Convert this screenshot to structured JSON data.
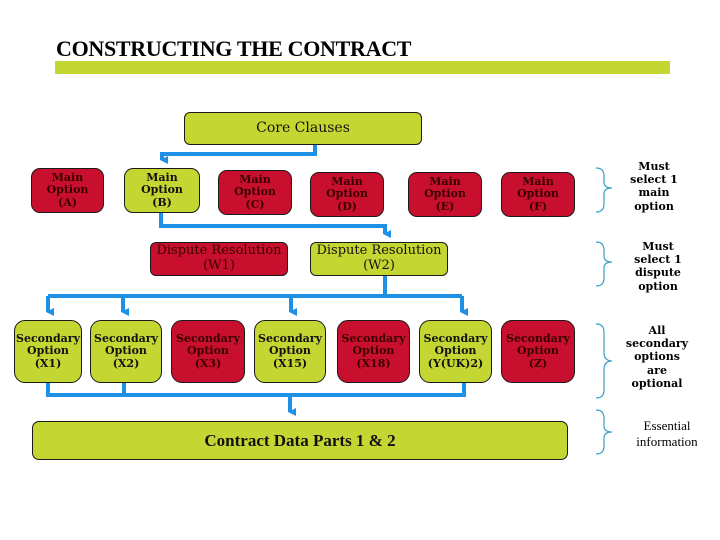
{
  "title": "CONSTRUCTING THE CONTRACT",
  "colors": {
    "selected": "#c4d632",
    "unselected": "#c8102e",
    "connector": "#1e90e6",
    "brace": "#3aa0c8"
  },
  "core_clauses": {
    "label": "Core Clauses",
    "state": "selected"
  },
  "main_options": [
    {
      "line1": "Main Option",
      "line2": "(A)",
      "state": "unselected"
    },
    {
      "line1": "Main Option",
      "line2": "(B)",
      "state": "selected"
    },
    {
      "line1": "Main Option",
      "line2": "(C)",
      "state": "unselected"
    },
    {
      "line1": "Main Option",
      "line2": "(D)",
      "state": "unselected"
    },
    {
      "line1": "Main Option",
      "line2": "(E)",
      "state": "unselected"
    },
    {
      "line1": "Main Option",
      "line2": "(F)",
      "state": "unselected"
    }
  ],
  "dispute_options": [
    {
      "line1": "Dispute Resolution",
      "line2": "(W1)",
      "state": "unselected"
    },
    {
      "line1": "Dispute Resolution",
      "line2": "(W2)",
      "state": "selected"
    }
  ],
  "secondary_options": [
    {
      "line1": "Secondary",
      "line2": "Option",
      "line3": "(X1)",
      "state": "selected"
    },
    {
      "line1": "Secondary",
      "line2": "Option",
      "line3": "(X2)",
      "state": "selected"
    },
    {
      "line1": "Secondary",
      "line2": "Option",
      "line3": "(X3)",
      "state": "unselected"
    },
    {
      "line1": "Secondary",
      "line2": "Option",
      "line3": "(X15)",
      "state": "selected"
    },
    {
      "line1": "Secondary",
      "line2": "Option",
      "line3": "(X18)",
      "state": "unselected"
    },
    {
      "line1": "Secondary",
      "line2": "Option",
      "line3": "(Y(UK)2)",
      "state": "selected"
    },
    {
      "line1": "Secondary",
      "line2": "Option",
      "line3": "(Z)",
      "state": "unselected"
    }
  ],
  "contract_data": {
    "label": "Contract Data Parts 1 & 2",
    "state": "selected"
  },
  "notes": [
    {
      "lines": [
        "Must",
        "select 1",
        "main",
        "option"
      ]
    },
    {
      "lines": [
        "Must",
        "select 1",
        "dispute",
        "option"
      ]
    },
    {
      "lines": [
        "All",
        "secondary",
        "options",
        "are",
        "optional"
      ]
    },
    {
      "lines": [
        "Essential",
        "information"
      ]
    }
  ]
}
